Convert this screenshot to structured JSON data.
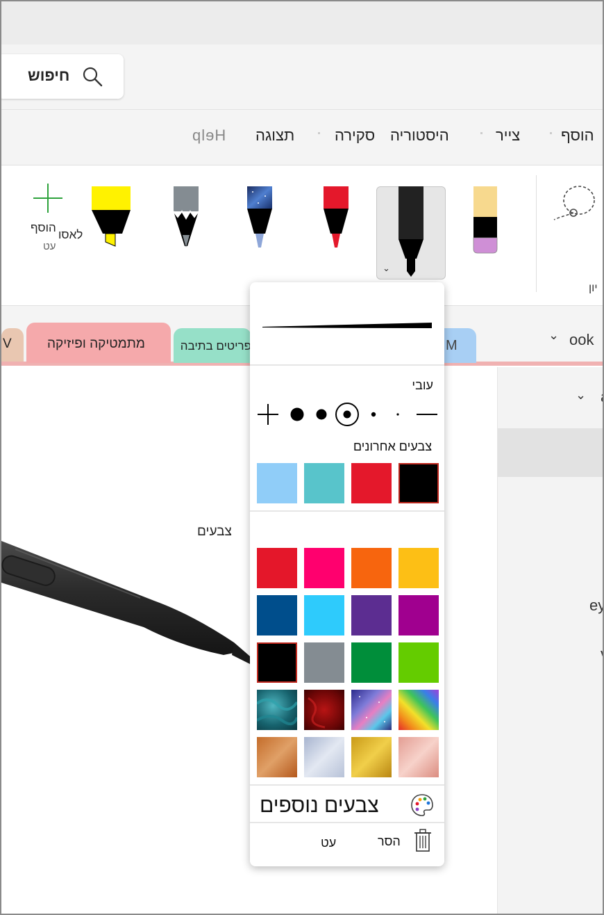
{
  "search": {
    "label": "חיפוש",
    "icon": "search-icon"
  },
  "menu_tabs": [
    {
      "label": "הוסף"
    },
    {
      "label": "צייר"
    },
    {
      "label": "היסטוריה"
    },
    {
      "label": "סקירה"
    },
    {
      "label": "תצוגה"
    },
    {
      "label": "Help"
    }
  ],
  "ribbon": {
    "add_pen_label": "הוסף",
    "add_pen_sub": "עט",
    "lasso_label": "לאסו",
    "group_label": "יון"
  },
  "sections": {
    "notebook_label": "ook",
    "tabs": [
      {
        "label": "M"
      },
      {
        "label": "פריטים בתיבה"
      },
      {
        "label": "מתמטיקה ופיזיקה"
      },
      {
        "label": "V"
      }
    ]
  },
  "right_pane": {
    "text1": "a",
    "text2": "ey",
    "text3": "v"
  },
  "canvas": {
    "colors_label": "צבעים"
  },
  "pen_popup": {
    "thickness_label": "עובי",
    "recent_colors_label": "צבעים אחרונים",
    "recent_colors": [
      "#000000",
      "#e4182b",
      "#58c4cb",
      "#90cdf8"
    ],
    "colors": [
      [
        "#fdbf15",
        "#f7650e",
        "#ff006e",
        "#e4172a"
      ],
      [
        "#a0008f",
        "#5c2d91",
        "#2ecbfc",
        "#004e8c"
      ],
      [
        "#64cc00",
        "#008e3a",
        "#848c92",
        "#000000"
      ]
    ],
    "more_colors_label": "צבעים נוספים",
    "remove_label": "הסר",
    "pen_label": "עט",
    "accent_color": "#c0281e"
  }
}
